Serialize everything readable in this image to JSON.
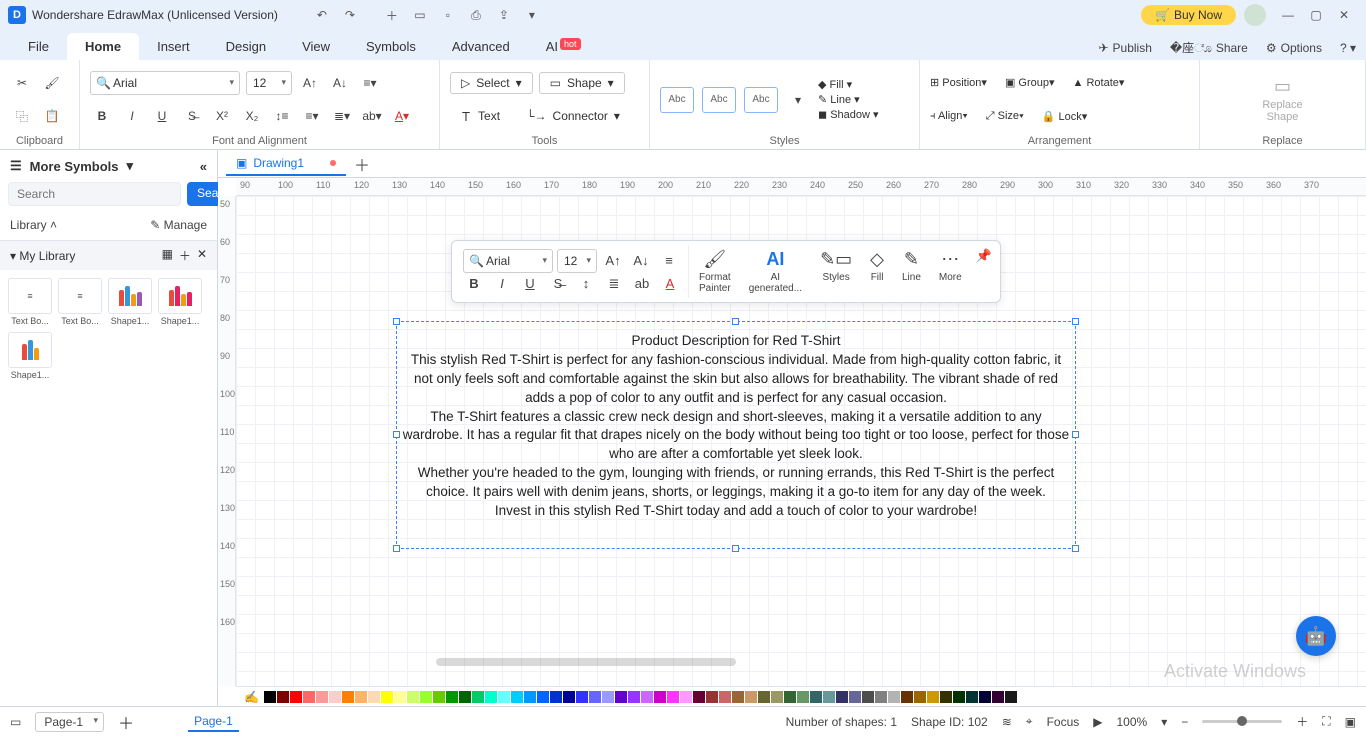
{
  "title_bar": {
    "app_title": "Wondershare EdrawMax (Unlicensed Version)",
    "buy_now": "Buy Now"
  },
  "menu": {
    "items": [
      "File",
      "Home",
      "Insert",
      "Design",
      "View",
      "Symbols",
      "Advanced",
      "AI"
    ],
    "right": {
      "publish": "Publish",
      "share": "Share",
      "options": "Options"
    }
  },
  "ribbon": {
    "clipboard_label": "Clipboard",
    "font_label": "Font and Alignment",
    "tools_label": "Tools",
    "styles_label": "Styles",
    "arrangement_label": "Arrangement",
    "replace_label": "Replace",
    "font_name": "Arial",
    "font_size": "12",
    "select": "Select",
    "shape": "Shape",
    "text": "Text",
    "connector": "Connector",
    "abc": "Abc",
    "fill": "Fill",
    "line": "Line",
    "shadow": "Shadow",
    "position": "Position",
    "align": "Align",
    "group": "Group",
    "size": "Size",
    "rotate": "Rotate",
    "lock": "Lock",
    "replace_shape": "Replace\nShape"
  },
  "left_panel": {
    "more_symbols": "More Symbols",
    "search_placeholder": "Search",
    "search_btn": "Search",
    "library": "Library",
    "manage": "Manage",
    "my_library": "My Library",
    "thumbs": [
      "Text Bo...",
      "Text Bo...",
      "Shape1...",
      "Shape1...",
      "Shape1..."
    ]
  },
  "doc": {
    "tab_name": "Drawing1"
  },
  "ruler_h": [
    90,
    100,
    110,
    120,
    130,
    140,
    150,
    160,
    170,
    180,
    190,
    200,
    210,
    220,
    230,
    240,
    250,
    260,
    270,
    280,
    290,
    300,
    310,
    320,
    330,
    340,
    350,
    360,
    370
  ],
  "ruler_v": [
    50,
    60,
    70,
    80,
    90,
    100,
    110,
    120,
    130,
    140,
    150,
    160
  ],
  "textbox": {
    "title": "Product Description for Red T-Shirt",
    "p1": "This stylish Red T-Shirt is perfect for any fashion-conscious individual. Made from high-quality cotton fabric, it not only feels soft and comfortable against the skin but also allows for breathability. The vibrant shade of red adds a pop of color to any outfit and is perfect for any casual occasion.",
    "p2": "The T-Shirt features a classic crew neck design and short-sleeves, making it a versatile addition to any wardrobe. It has a regular fit that drapes nicely on the body without being too tight or too loose, perfect for those who are after a comfortable yet sleek look.",
    "p3": "Whether you're headed to the gym, lounging with friends, or running errands, this Red T-Shirt is the perfect choice. It pairs well with denim jeans, shorts, or leggings, making it a go-to item for any day of the week.",
    "p4": "Invest in this stylish Red T-Shirt today and add a touch of color to your wardrobe!"
  },
  "float_tb": {
    "font_name": "Arial",
    "font_size": "12",
    "format_painter": "Format\nPainter",
    "ai_generated": "AI\ngenerated...",
    "styles": "Styles",
    "fill": "Fill",
    "line": "Line",
    "more": "More"
  },
  "status": {
    "page_selector": "Page-1",
    "page_tab": "Page-1",
    "num_shapes": "Number of shapes: 1",
    "shape_id": "Shape ID: 102",
    "focus": "Focus",
    "zoom": "100%"
  },
  "watermark": "Activate Windows",
  "colors": [
    "#000000",
    "#7f0000",
    "#ff0000",
    "#ff6666",
    "#ff9999",
    "#ffcccc",
    "#ff8000",
    "#ffb366",
    "#ffd9b3",
    "#ffff00",
    "#ffff99",
    "#ccff66",
    "#99ff33",
    "#66cc00",
    "#009900",
    "#006600",
    "#00cc66",
    "#00ffcc",
    "#66ffff",
    "#00ccff",
    "#0099ff",
    "#0066ff",
    "#0033cc",
    "#000099",
    "#3333ff",
    "#6666ff",
    "#9999ff",
    "#6600cc",
    "#9933ff",
    "#cc66ff",
    "#cc00cc",
    "#ff33ff",
    "#ff99ff",
    "#660033",
    "#993333",
    "#cc6666",
    "#996633",
    "#cc9966",
    "#666633",
    "#999966",
    "#336633",
    "#669966",
    "#336666",
    "#669999",
    "#333366",
    "#666699",
    "#4d4d4d",
    "#808080",
    "#b3b3b3",
    "#663300",
    "#996600",
    "#cc9900",
    "#333300",
    "#003300",
    "#003333",
    "#000033",
    "#330033",
    "#1a1a1a"
  ]
}
